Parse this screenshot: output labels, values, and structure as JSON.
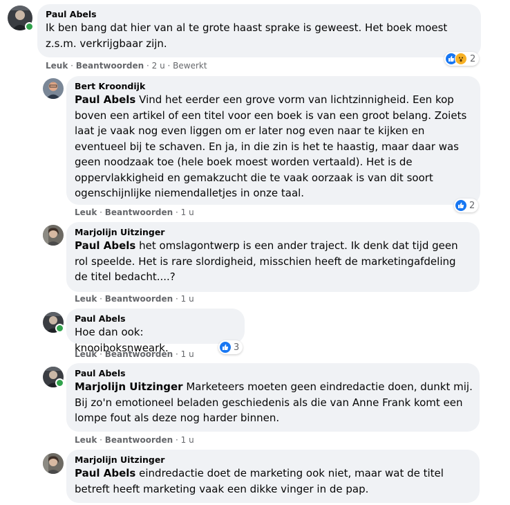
{
  "comments": [
    {
      "author": "Paul Abels",
      "mention": "",
      "text": "Ik ben bang dat hier van al te grote haast sprake is geweest. Het boek moest z.s.m. verkrijgbaar zijn.",
      "like_label": "Leuk",
      "reply_label": "Beantwoorden",
      "time": "2 u",
      "edited": "Bewerkt",
      "reaction_count": "2",
      "reaction_icons": [
        "like-icon",
        "wow-icon"
      ],
      "online": true
    },
    {
      "author": "Bert Kroondijk",
      "mention": "Paul Abels",
      "text": "Vind het eerder een grove vorm van lichtzinnigheid. Een kop boven een artikel of een titel voor een boek is van een groot belang. Zoiets laat je vaak nog even liggen om er later nog even naar te kijken en eventueel bij te schaven. En ja, in die zin is het te haastig, maar daar was geen noodzaak toe (hele boek moest worden vertaald). Het is de oppervlakkigheid en gemakzucht die te vaak oorzaak is van dit soort ogenschijnlijke niemendalletjes in onze taal.",
      "like_label": "Leuk",
      "reply_label": "Beantwoorden",
      "time": "1 u",
      "reaction_count": "2",
      "reaction_icons": [
        "like-icon"
      ],
      "online": false
    },
    {
      "author": "Marjolijn Uitzinger",
      "mention": "Paul Abels",
      "text": "het omslagontwerp is een ander traject. Ik denk dat tijd geen rol speelde. Het is rare slordigheid, misschien heeft de marketingafdeling de titel bedacht....?",
      "like_label": "Leuk",
      "reply_label": "Beantwoorden",
      "time": "1 u",
      "online": false
    },
    {
      "author": "Paul Abels",
      "mention": "",
      "text": "Hoe dan ook: knooiboksnweark.",
      "like_label": "Leuk",
      "reply_label": "Beantwoorden",
      "time": "1 u",
      "reaction_count": "3",
      "reaction_icons": [
        "like-icon"
      ],
      "online": true
    },
    {
      "author": "Paul Abels",
      "mention": "Marjolijn Uitzinger",
      "text": "Marketeers moeten geen eindredactie doen, dunkt mij. Bij zo'n emotioneel beladen geschiedenis als die van Anne Frank komt een lompe fout als deze nog harder binnen.",
      "like_label": "Leuk",
      "reply_label": "Beantwoorden",
      "time": "1 u",
      "online": true
    },
    {
      "author": "Marjolijn Uitzinger",
      "mention": "Paul Abels",
      "text": "eindredactie doet de marketing ook niet, maar wat de titel betreft heeft marketing vaak een dikke vinger in de pap.",
      "online": false
    }
  ],
  "colors": {
    "bubble": "#f0f2f5",
    "meta_text": "#65676b",
    "like_blue": "#1877f2",
    "online_green": "#31a24c"
  }
}
